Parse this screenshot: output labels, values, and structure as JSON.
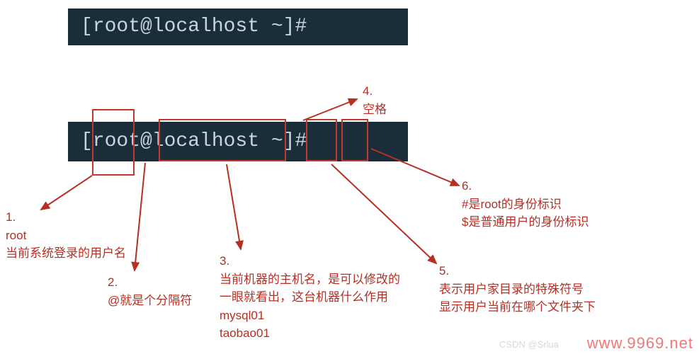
{
  "terminal": {
    "prompt1": "[root@localhost ~]# ",
    "prompt2": "[root@localhost ~]# "
  },
  "annotations": {
    "a1": {
      "num": "1.",
      "l1": "root",
      "l2": "当前系统登录的用户名"
    },
    "a2": {
      "num": "2.",
      "l1": "@就是个分隔符"
    },
    "a3": {
      "num": "3.",
      "l1": "当前机器的主机名，是可以修改的",
      "l2": "一眼就看出，这台机器什么作用",
      "l3": "mysql01",
      "l4": "taobao01"
    },
    "a4": {
      "num": "4.",
      "l1": "空格"
    },
    "a5": {
      "num": "5.",
      "l1": "表示用户家目录的特殊符号",
      "l2": "显示用户当前在哪个文件夹下"
    },
    "a6": {
      "num": "6.",
      "l1": "#是root的身份标识",
      "l2": "$是普通用户的身份标识"
    }
  },
  "watermark": {
    "csdn": "CSDN @Srlua",
    "site": "www.9969.net"
  },
  "style": {
    "arrow_color": "#b52f24"
  }
}
